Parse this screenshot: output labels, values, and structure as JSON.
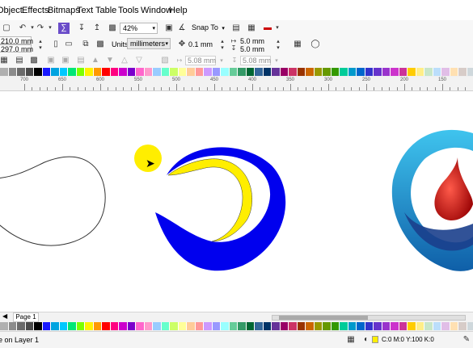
{
  "menu": [
    "Object",
    "Effects",
    "Bitmaps",
    "Text",
    "Table",
    "Tools",
    "Window",
    "Help"
  ],
  "toolbar1": {
    "zoom": "42%",
    "snap_to": "Snap To"
  },
  "toolbar2": {
    "page_width": "210.0 mm",
    "page_height": "297.0 mm",
    "units_label": "Units:",
    "units_value": "millimeters",
    "nudge": "0.1 mm",
    "dup_x": "5.0 mm",
    "dup_y": "5.0 mm"
  },
  "toolbar3": {
    "value_a": "5.08 mm",
    "value_b": "5.08 mm"
  },
  "ruler": {
    "labels": [
      "700",
      "650",
      "600",
      "550",
      "500",
      "450",
      "400",
      "350",
      "300",
      "250",
      "200",
      "150"
    ]
  },
  "palette": {
    "colors": [
      "#b0b0b0",
      "#8c8c8c",
      "#6a6a6a",
      "#4a4a4a",
      "#000000",
      "#1a1aff",
      "#00a3e0",
      "#00c8ff",
      "#00e676",
      "#7cff00",
      "#fff200",
      "#ff9900",
      "#ff0000",
      "#ff0080",
      "#cc00cc",
      "#7a00cc",
      "#ff66cc",
      "#ff99cc",
      "#99ccff",
      "#66ffcc",
      "#ccff66",
      "#ffff99",
      "#ffcc99",
      "#ff9999",
      "#cc99ff",
      "#9999ff",
      "#99ffff",
      "#66cc99",
      "#339966",
      "#006633",
      "#336699",
      "#003366",
      "#663399",
      "#990066",
      "#cc3366",
      "#993300",
      "#cc6600",
      "#999900",
      "#669900",
      "#339900",
      "#00cc99",
      "#0099cc",
      "#0066cc",
      "#3333cc",
      "#6633cc",
      "#9933cc",
      "#cc33cc",
      "#cc3399",
      "#ffcc00",
      "#ffee88",
      "#c8e6c9",
      "#bbdefb",
      "#e1bee7",
      "#ffe0b2",
      "#d7ccc8",
      "#cfd8dc"
    ]
  },
  "page_tab": "Page 1",
  "status": {
    "layer_text": "e on Layer 1",
    "fill_text": "C:0 M:0 Y:100 K:0"
  },
  "colors": {
    "yellow": "#ffee00",
    "blue": "#0000ee",
    "drop_red": "#cc1111",
    "logo_cyan": "#1aa8e0"
  }
}
